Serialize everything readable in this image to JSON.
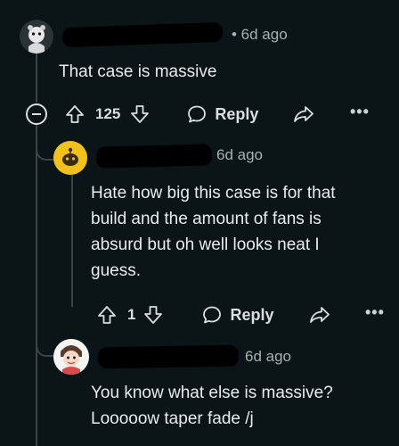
{
  "comments": [
    {
      "username": "",
      "time": "• 6d ago",
      "body": "That case is massive",
      "votes": "125",
      "reply_label": "Reply"
    },
    {
      "username": "",
      "time": "6d ago",
      "body": "Hate how big this case is for that build and the amount of fans is absurd but oh well looks neat I guess.",
      "votes": "1",
      "reply_label": "Reply"
    },
    {
      "username": "",
      "time": "6d ago",
      "body": "You know what else is massive? Looooow taper fade /j"
    }
  ],
  "icons": {
    "collapse": "minus-circle-icon",
    "upvote": "arrow-up-icon",
    "downvote": "arrow-down-icon",
    "reply": "speech-bubble-icon",
    "share": "share-arrow-icon",
    "more": "ellipsis-icon"
  },
  "colors": {
    "background": "#0b1416",
    "avatar2": "#f2c21a"
  }
}
